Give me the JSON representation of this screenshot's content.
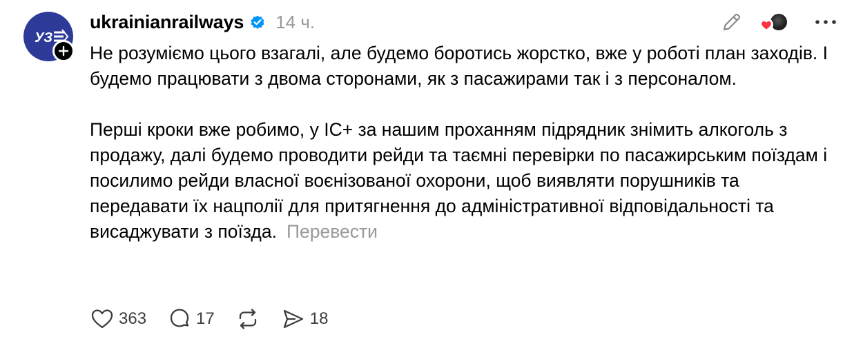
{
  "post": {
    "username": "ukrainianrailways",
    "timestamp": "14 ч.",
    "avatar_text": "УЗ",
    "paragraphs": [
      "Не розуміємо цього взагалі, але будемо боротись жорстко, вже у роботі план заходів. І будемо працювати з двома сторонами, як з пасажирами так і з персоналом.",
      "Перші кроки вже робимо, у ІС+ за нашим проханням підрядник знімить алкоголь з продажу, далі будемо проводити рейди та таємні перевірки по пасажирським поїздам і посилимо рейди власної воєнізованої охорони, щоб виявляти порушників та передавати їх нацполії для притягнення до адміністративної відповідальності та висаджувати з поїзда."
    ],
    "translate_label": "Перевести"
  },
  "actions": {
    "likes": "363",
    "replies": "17",
    "shares": "18"
  },
  "icons": {
    "verified": "verified-badge-icon",
    "edit": "pencil-icon",
    "more": "more-horizontal-icon",
    "like": "heart-icon",
    "reply": "speech-bubble-icon",
    "repost": "repost-icon",
    "share": "send-icon",
    "follow": "plus-icon"
  },
  "colors": {
    "avatar_bg": "#2d3a97",
    "verified_blue": "#0095f6",
    "muted_text": "#999999",
    "heart_red": "#ff3040"
  }
}
